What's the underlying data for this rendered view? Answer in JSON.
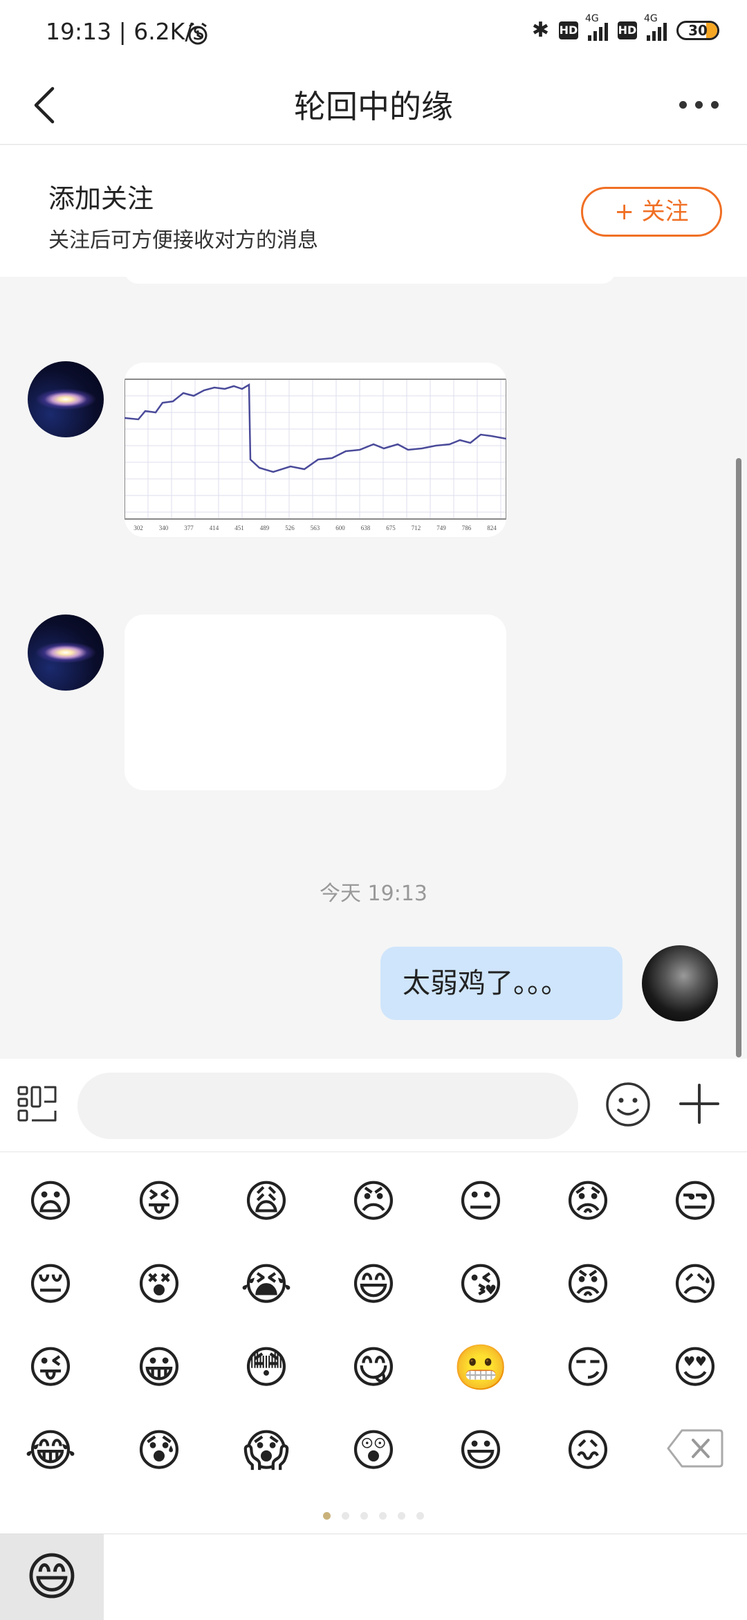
{
  "status_bar": {
    "time_speed": "19:13 | 6.2K/s",
    "hd1": "HD",
    "net1": "4G",
    "hd2": "HD",
    "net2": "4G",
    "battery": "30"
  },
  "nav": {
    "title": "轮回中的缘"
  },
  "follow": {
    "title": "添加关注",
    "subtitle": "关注后可方便接收对方的消息",
    "button": "+ 关注"
  },
  "chat": {
    "timestamp": "今天 19:13",
    "my_message": "太弱鸡了。。。",
    "chart_image": {
      "tick_labels": [
        "302",
        "340",
        "377",
        "414",
        "451",
        "489",
        "526",
        "563",
        "600",
        "638",
        "675",
        "712",
        "749",
        "786",
        "824"
      ]
    }
  },
  "emojis": [
    "😦",
    "😝",
    "😩",
    "😠",
    "😐",
    "😟",
    "😒",
    "😔",
    "😵",
    "😭",
    "😄",
    "😘",
    "😡",
    "😥",
    "😜",
    "😀",
    "😳",
    "😋",
    "😬",
    "😏",
    "😍",
    "😂",
    "😰",
    "😱",
    "😲",
    "😃",
    "😖"
  ],
  "emoji_page": {
    "current": 1,
    "total": 6
  },
  "emoji_tab_icon": "😄"
}
